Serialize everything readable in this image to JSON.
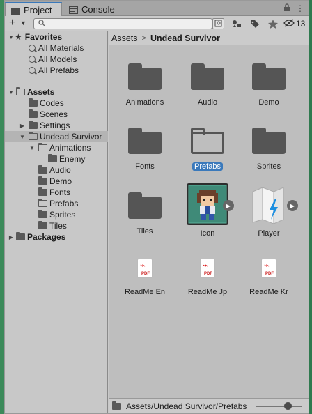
{
  "tabs": [
    {
      "label": "Project",
      "icon": "folder-icon"
    },
    {
      "label": "Console",
      "icon": "console-icon"
    }
  ],
  "tab_actions": [
    "lock-icon",
    "kebab-menu-icon"
  ],
  "toolbar": {
    "search_placeholder": "",
    "hidden_count": "13"
  },
  "tree": {
    "favorites_label": "Favorites",
    "favorites": [
      "All Materials",
      "All Models",
      "All Prefabs"
    ],
    "assets_label": "Assets",
    "assets": [
      "Codes",
      "Scenes",
      "Settings"
    ],
    "selected_folder": "Undead Survivor",
    "undead_children": [
      "Audio",
      "Demo",
      "Fonts",
      "Prefabs",
      "Sprites",
      "Tiles"
    ],
    "animations_label": "Animations",
    "enemy_label": "Enemy",
    "packages_label": "Packages"
  },
  "breadcrumb": {
    "root": "Assets",
    "current": "Undead Survivor"
  },
  "grid": {
    "items": [
      {
        "label": "Animations",
        "kind": "folder"
      },
      {
        "label": "Audio",
        "kind": "folder"
      },
      {
        "label": "Demo",
        "kind": "folder"
      },
      {
        "label": "Fonts",
        "kind": "folder"
      },
      {
        "label": "Prefabs",
        "kind": "folder-empty",
        "selected": true
      },
      {
        "label": "Sprites",
        "kind": "folder"
      },
      {
        "label": "Tiles",
        "kind": "folder"
      },
      {
        "label": "Icon",
        "kind": "sprite"
      },
      {
        "label": "Player",
        "kind": "animator"
      },
      {
        "label": "ReadMe En",
        "kind": "pdf"
      },
      {
        "label": "ReadMe Jp",
        "kind": "pdf"
      },
      {
        "label": "ReadMe Kr",
        "kind": "pdf"
      }
    ]
  },
  "status": {
    "path": "Assets/Undead Survivor/Prefabs",
    "zoom_level": 0.55
  },
  "colors": {
    "selection": "#3a79bb",
    "folder": "#555555"
  }
}
